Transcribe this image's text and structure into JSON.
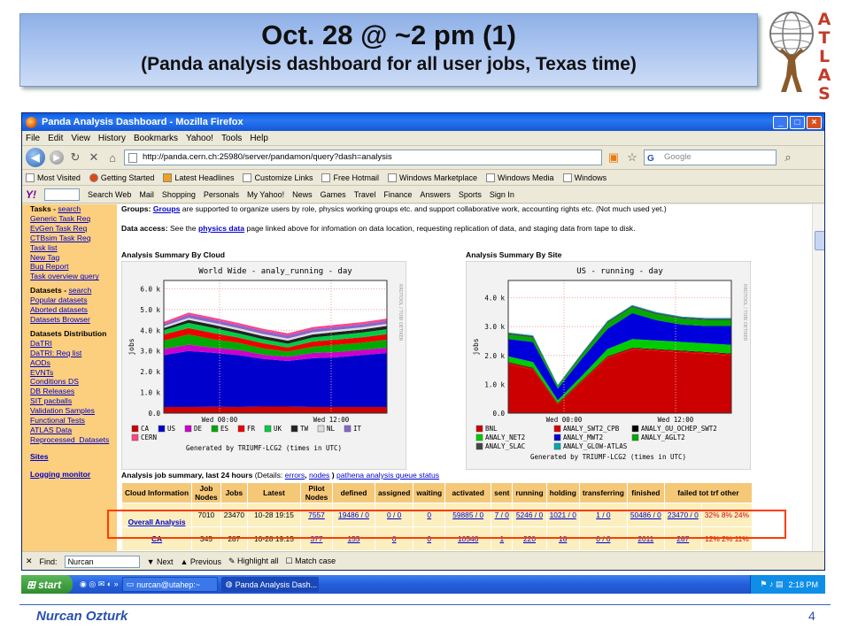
{
  "slide": {
    "title": "Oct. 28 @ ~2 pm (1)",
    "subtitle": "(Panda analysis dashboard for all user jobs, Texas time)",
    "logo_letters": [
      "A",
      "T",
      "L",
      "A",
      "S"
    ],
    "author": "Nurcan Ozturk",
    "page_number": "4"
  },
  "browser": {
    "window_title": "Panda Analysis Dashboard - Mozilla Firefox",
    "menu": [
      "File",
      "Edit",
      "View",
      "History",
      "Bookmarks",
      "Yahoo!",
      "Tools",
      "Help"
    ],
    "url": "http://panda.cern.ch:25980/server/pandamon/query?dash=analysis",
    "search_placeholder": "Google",
    "bookmarks": [
      "Most Visited",
      "Getting Started",
      "Latest Headlines",
      "Customize Links",
      "Free Hotmail",
      "Windows Marketplace",
      "Windows Media",
      "Windows"
    ],
    "yahoo_toolbar": [
      "Search Web",
      "Mail",
      "Shopping",
      "Personals",
      "My Yahoo!",
      "News",
      "Games",
      "Travel",
      "Finance",
      "Answers",
      "Sports",
      "Sign In"
    ],
    "find": {
      "label": "Find:",
      "value": "Nurcan",
      "next": "Next",
      "previous": "Previous",
      "highlight": "Highlight all",
      "match_case": "Match case"
    }
  },
  "leftnav": {
    "tasks_label": "Tasks",
    "tasks_search": "search",
    "tasks_links": [
      "Generic Task Req",
      "EvGen Task Req",
      "CTBsim Task Req",
      "Task list",
      "New Tag",
      "Bug Report",
      "Task overview query"
    ],
    "datasets_label": "Datasets",
    "datasets_search": "search",
    "datasets_links": [
      "Popular datasets",
      "Aborted datasets",
      "Datasets Browser"
    ],
    "distribution_label": "Datasets Distribution",
    "distribution_links": [
      "DaTRI",
      "DaTRI: Req list",
      "AODs",
      "EVNTs",
      "Conditions DS",
      "DB Releases",
      "SIT pacballs",
      "Validation Samples",
      "Functional Tests",
      "ATLAS Data",
      "Reprocessed_Datasets"
    ],
    "sites": "Sites",
    "logging": "Logging monitor"
  },
  "main": {
    "groups_label": "Groups:",
    "groups_link": "Groups",
    "groups_text": "are supported to organize users by role, physics working groups etc. and support collaborative work, accounting rights etc. (Not much used yet.)",
    "data_access_label": "Data access:",
    "data_access_pre": "See the",
    "data_access_link": "physics data",
    "data_access_text": "page linked above for infomation on data location, requesting replication of data, and staging data from tape to disk.",
    "summary_label": "Analysis job summary, last 24 hours",
    "summary_details": "(Details:",
    "summary_links": [
      "errors",
      "nodes",
      "pathena analysis queue status"
    ]
  },
  "chart_data": [
    {
      "type": "area",
      "heading": "Analysis Summary By Cloud",
      "title": "World Wide - analy_running - day",
      "ylabel": "jobs",
      "xlabel": "Wed 12:00",
      "x_ticks": [
        "Wed 00:00",
        "Wed 12:00"
      ],
      "y_ticks": [
        "0.0",
        "1.0 k",
        "2.0 k",
        "3.0 k",
        "4.0 k",
        "5.0 k",
        "6.0 k"
      ],
      "ylim": [
        0,
        6400
      ],
      "footer": "Generated by TRIUMF-LCG2 (times in UTC)",
      "side_label": "RRDTOOL / TOBI OETIKER",
      "legend_position": "bottom",
      "series": [
        {
          "name": "CA",
          "color": "#cc0000",
          "values": [
            300,
            300,
            310,
            300,
            320,
            320,
            300,
            300,
            300,
            300
          ]
        },
        {
          "name": "US",
          "color": "#0000cc",
          "values": [
            2500,
            2700,
            2600,
            2500,
            2300,
            2200,
            2350,
            2400,
            2500,
            2600
          ]
        },
        {
          "name": "DE",
          "color": "#cc00cc",
          "values": [
            300,
            300,
            250,
            250,
            200,
            200,
            250,
            250,
            250,
            260
          ]
        },
        {
          "name": "ES",
          "color": "#00aa00",
          "values": [
            400,
            500,
            400,
            350,
            300,
            250,
            300,
            350,
            350,
            380
          ]
        },
        {
          "name": "FR",
          "color": "#ee0000",
          "values": [
            300,
            300,
            300,
            250,
            250,
            200,
            250,
            250,
            260,
            270
          ]
        },
        {
          "name": "UK",
          "color": "#00cc44",
          "values": [
            200,
            250,
            250,
            200,
            200,
            180,
            200,
            220,
            230,
            240
          ]
        },
        {
          "name": "TW",
          "color": "#222222",
          "values": [
            100,
            150,
            150,
            150,
            150,
            150,
            150,
            150,
            150,
            160
          ]
        },
        {
          "name": "NL",
          "color": "#dddddd",
          "values": [
            100,
            100,
            100,
            100,
            100,
            100,
            100,
            100,
            100,
            100
          ]
        },
        {
          "name": "IT",
          "color": "#8866cc",
          "values": [
            100,
            150,
            150,
            150,
            150,
            150,
            150,
            150,
            150,
            150
          ]
        },
        {
          "name": "CERN",
          "color": "#ff4488",
          "values": [
            100,
            100,
            100,
            100,
            100,
            100,
            100,
            100,
            100,
            100
          ]
        }
      ]
    },
    {
      "type": "area",
      "heading": "Analysis Summary By Site",
      "title": "US - running - day",
      "ylabel": "jobs",
      "xlabel": "Wed 12:00",
      "x_ticks": [
        "Wed 00:00",
        "Wed 12:00"
      ],
      "y_ticks": [
        "0.0",
        "1.0 k",
        "2.0 k",
        "3.0 k",
        "4.0 k"
      ],
      "ylim": [
        0,
        4600
      ],
      "footer": "Generated by TRIUMF-LCG2 (times in UTC)",
      "side_label": "RRDTOOL / TOBI OETIKER",
      "legend_position": "bottom",
      "series": [
        {
          "name": "BNL",
          "color": "#cc0000",
          "values": [
            1700,
            1500,
            300,
            1100,
            1900,
            2200,
            2150,
            2100,
            2050,
            2000
          ]
        },
        {
          "name": "ANALY_SWT2_CPB",
          "color": "#dd0000",
          "values": [
            50,
            50,
            30,
            50,
            50,
            50,
            50,
            50,
            50,
            50
          ]
        },
        {
          "name": "ANALY_OU_OCHEP_SWT2",
          "color": "#000000",
          "values": [
            20,
            20,
            20,
            20,
            20,
            20,
            20,
            20,
            20,
            20
          ]
        },
        {
          "name": "ANALY_NET2",
          "color": "#00cc00",
          "values": [
            200,
            200,
            100,
            150,
            250,
            300,
            300,
            300,
            300,
            300
          ]
        },
        {
          "name": "ANALY_MWT2",
          "color": "#0000dd",
          "values": [
            600,
            700,
            400,
            600,
            700,
            900,
            700,
            600,
            600,
            650
          ]
        },
        {
          "name": "ANALY_AGLT2",
          "color": "#00aa00",
          "values": [
            150,
            150,
            80,
            120,
            200,
            200,
            200,
            200,
            200,
            200
          ]
        },
        {
          "name": "ANALY_SLAC",
          "color": "#444444",
          "values": [
            50,
            50,
            30,
            50,
            50,
            50,
            50,
            50,
            50,
            50
          ]
        },
        {
          "name": "ANALY_GLOW-ATLAS",
          "color": "#00aaaa",
          "values": [
            30,
            30,
            20,
            30,
            30,
            30,
            30,
            30,
            30,
            30
          ]
        }
      ]
    }
  ],
  "job_table": {
    "headers": [
      "Cloud Information",
      "Job Nodes",
      "Jobs",
      "Latest",
      "Pilot Nodes",
      "defined",
      "assigned",
      "waiting",
      "activated",
      "sent",
      "running",
      "holding",
      "transferring",
      "finished",
      "failed tot trf other"
    ],
    "rows": [
      {
        "cloud": "Overall Analysis",
        "job_nodes": "7010",
        "jobs": "23470",
        "latest": "10-28 19:15",
        "pilot_nodes": "7557",
        "defined": "19486 / 0",
        "assigned": "0 / 0",
        "waiting": "0",
        "activated": "59885 / 0",
        "sent": "7 / 0",
        "running": "5246 / 0",
        "holding": "1021 / 0",
        "transferring": "1 / 0",
        "finished": "50486 / 0",
        "failed": "23470 / 0",
        "failed_pct": "32% 8% 24%"
      },
      {
        "cloud": "CA",
        "job_nodes": "345",
        "jobs": "287",
        "latest": "10-28 19:15",
        "pilot_nodes": "377",
        "defined": "155",
        "assigned": "0",
        "waiting": "0",
        "activated": "10546",
        "sent": "1",
        "running": "220",
        "holding": "18",
        "transferring": "0 / 0",
        "finished": "2011",
        "failed": "287",
        "failed_pct": "12% 2% 11%"
      }
    ]
  },
  "taskbar": {
    "start": "start",
    "tasks": [
      "nurcan@utahep:~",
      "Panda Analysis Dash..."
    ],
    "clock": "2:18 PM"
  }
}
